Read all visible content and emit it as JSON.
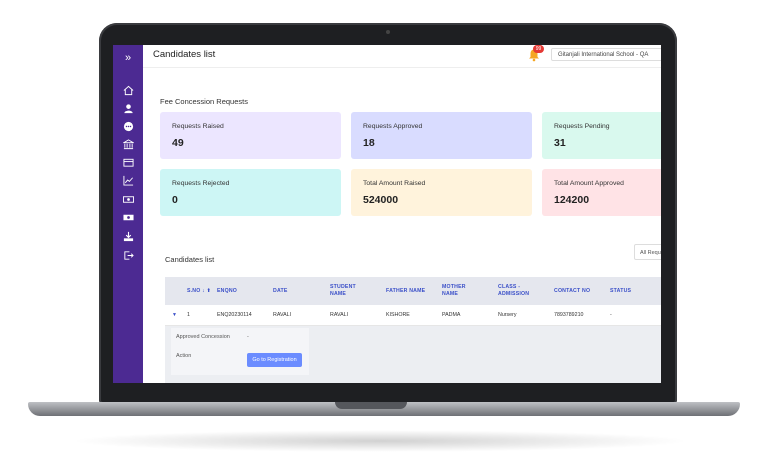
{
  "header": {
    "title": "Candidates list",
    "notification_count": "99",
    "school": "Gitanjali International School - QA"
  },
  "section": {
    "title": "Fee Concession Requests"
  },
  "cards": [
    {
      "label": "Requests Raised",
      "value": "49",
      "color": "#ece6ff"
    },
    {
      "label": "Requests Approved",
      "value": "18",
      "color": "#d9dcff"
    },
    {
      "label": "Requests Pending",
      "value": "31",
      "color": "#d9f9ee"
    },
    {
      "label": "Requests Rejected",
      "value": "0",
      "color": "#cdf6f5"
    },
    {
      "label": "Total Amount Raised",
      "value": "524000",
      "color": "#fff3dc"
    },
    {
      "label": "Total Amount Approved",
      "value": "124200",
      "color": "#ffe3e6"
    }
  ],
  "list": {
    "title": "Candidates list",
    "filter": "All Requ",
    "columns": [
      "S.NO ↓ ⬆",
      "ENQNO",
      "DATE",
      "STUDENT NAME",
      "FATHER NAME",
      "MOTHER NAME",
      "CLASS - ADMISSION",
      "CONTACT NO",
      "STATUS"
    ],
    "rows": [
      {
        "sno": "1",
        "enqno": "ENQ20230114",
        "date": "RAVALI",
        "student": "RAVALI",
        "father": "KISHORE",
        "mother": "PADMA",
        "class": "Nursery",
        "contact": "7893789210",
        "status": "-"
      }
    ],
    "detail": {
      "approved_label": "Approved Concession",
      "approved_value": "-",
      "action_label": "Action",
      "button": "Go to Registration"
    }
  },
  "colors": {
    "sidebar": "#4c2a92",
    "accent": "#3a4fc8",
    "button": "#6b8cff"
  },
  "sidebar_icons": [
    "home-icon",
    "user-icon",
    "chat-icon",
    "bank-icon",
    "cards-icon",
    "chart-icon",
    "money-icon",
    "money-alt-icon",
    "download-icon",
    "logout-icon"
  ]
}
